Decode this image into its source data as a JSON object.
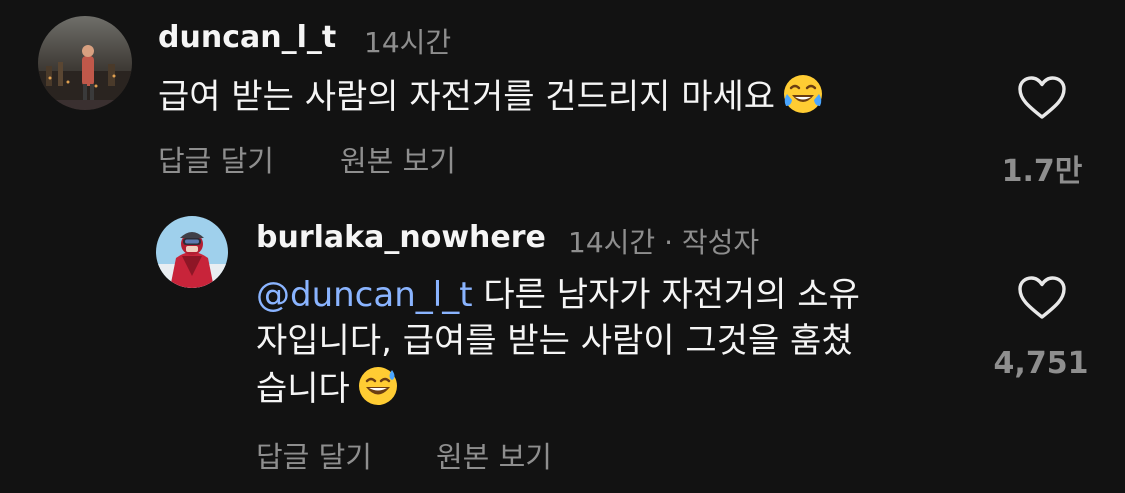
{
  "comments": [
    {
      "username": "duncan_l_t",
      "time": "14시간",
      "text": "급여 받는 사람의 자전거를 건드리지 마세요",
      "emoji": "face-with-tears-of-joy",
      "reply_label": "답글 달기",
      "original_label": "원본 보기",
      "like_count": "1.7만"
    },
    {
      "username": "burlaka_nowhere",
      "time": "14시간",
      "author_badge": "· 작성자",
      "mention": "@duncan_l_t",
      "text_line1": "다른 남자가 자전거의 소유",
      "text_line2": "자입니다, 급여를 받는 사람이 그것을 훔쳤",
      "text_line3": "습니다",
      "emoji": "grinning-face-with-sweat",
      "reply_label": "답글 달기",
      "original_label": "원본 보기",
      "like_count": "4,751"
    }
  ],
  "colors": {
    "background": "#121212",
    "text": "#f5f5f5",
    "muted": "#8e8e8e",
    "mention": "#8ab4ff"
  }
}
